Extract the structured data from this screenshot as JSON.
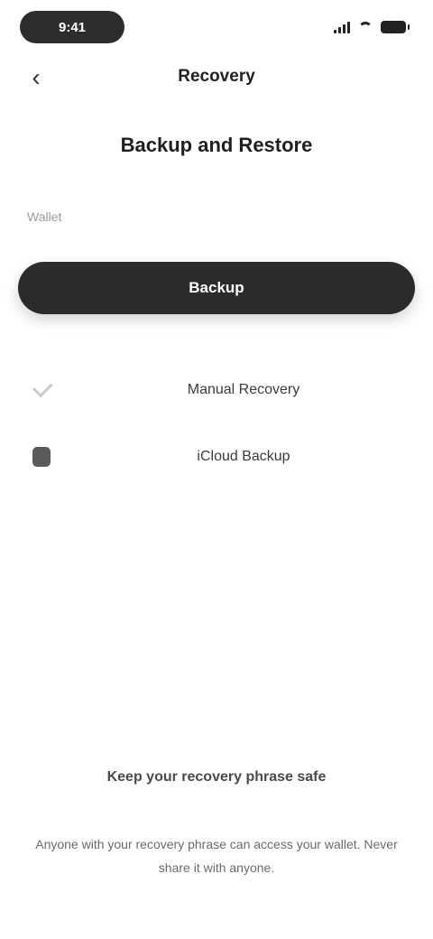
{
  "status_bar": {
    "time": "9:41"
  },
  "nav": {
    "back_icon": "chevron-left-icon",
    "title": "Recovery"
  },
  "page": {
    "heading": "Backup and Restore"
  },
  "section": {
    "label": "Wallet"
  },
  "primary_action": {
    "label": "Backup"
  },
  "options": [
    {
      "icon": "check-icon",
      "label": "Manual Recovery"
    },
    {
      "icon": "square-icon",
      "label": "iCloud Backup"
    }
  ],
  "footer": {
    "title": "Keep your recovery phrase safe",
    "text": "Anyone with your recovery phrase can access your wallet. Never share it with anyone."
  },
  "colors": {
    "button_bg": "#2b2b2d",
    "status_pill_bg": "#2d2d2f",
    "muted_text": "#9a9a9a"
  }
}
